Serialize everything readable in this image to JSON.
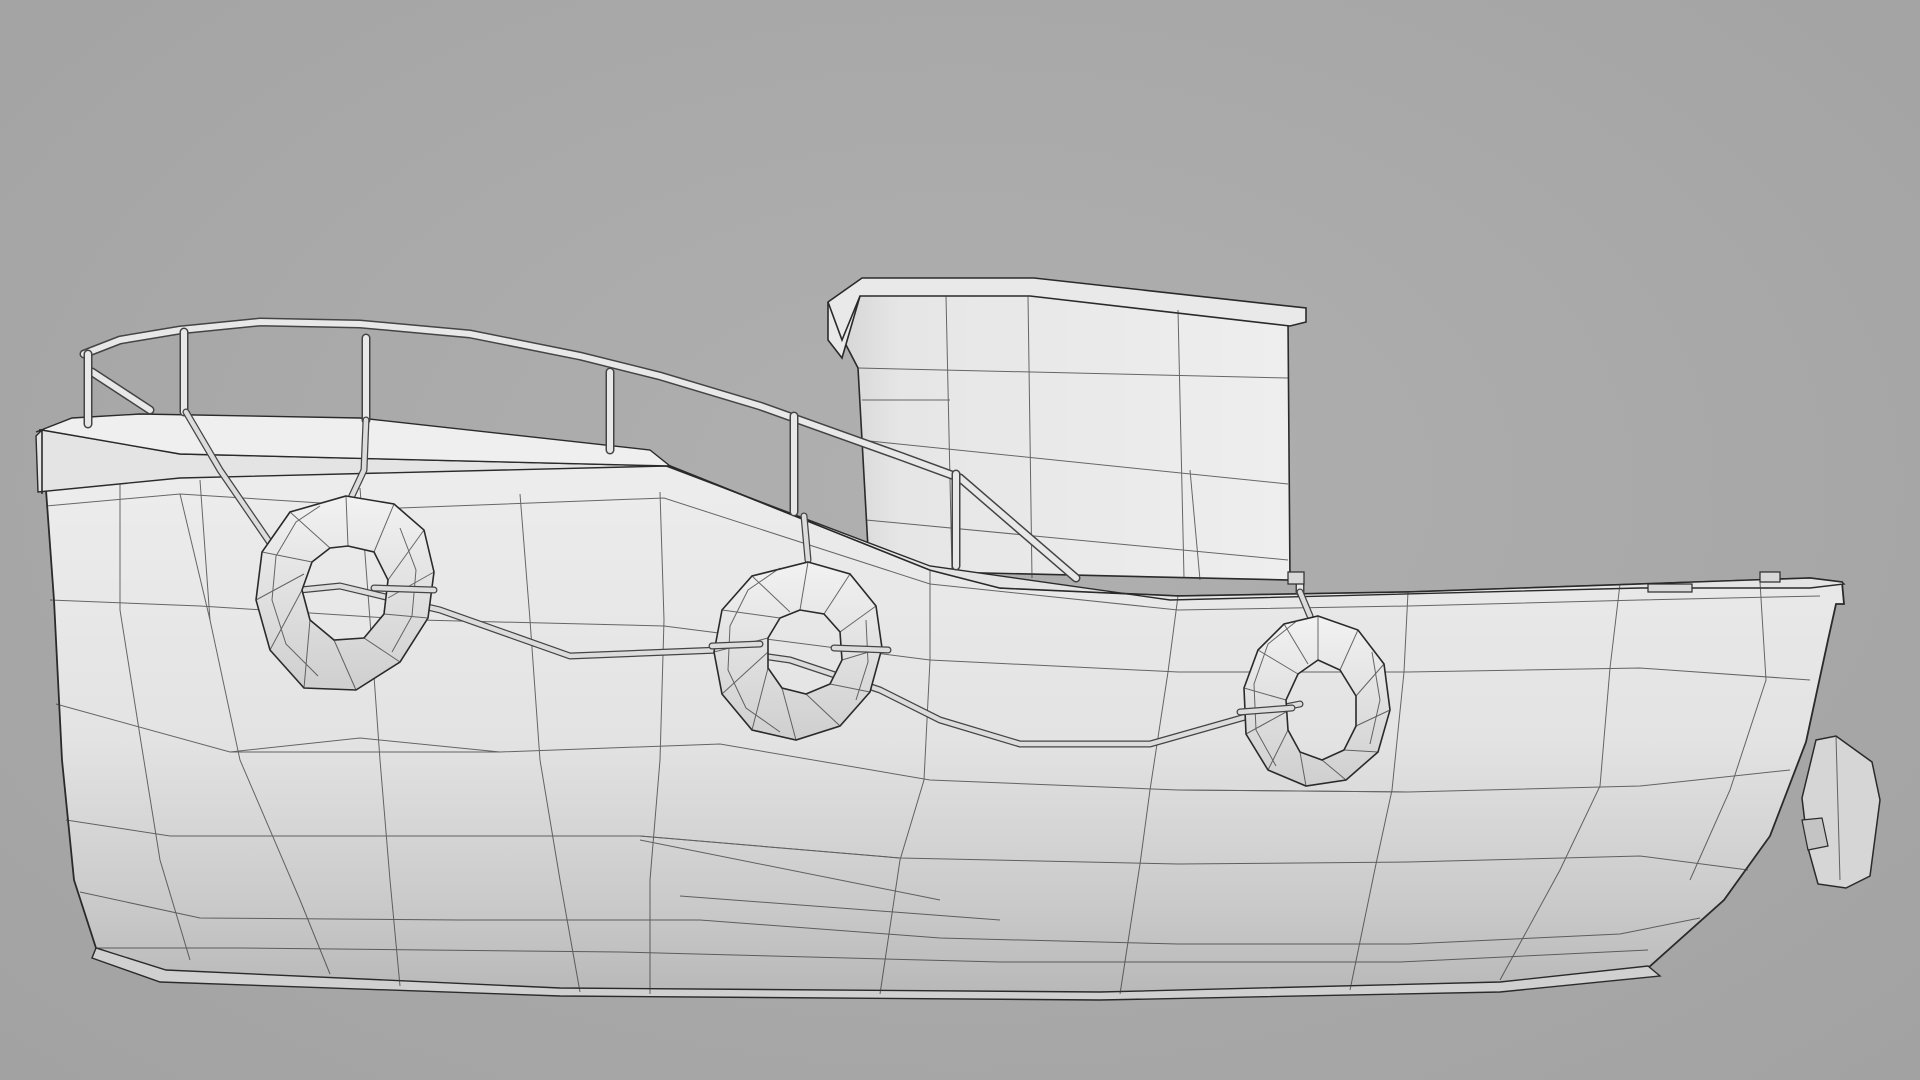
{
  "scene": {
    "subject": "boat",
    "colors": {
      "background": "#a9a9a9",
      "hull_light": "#ededed",
      "hull_mid": "#d9d9d9",
      "hull_shadow": "#bdbdbd",
      "wire": "#3a3a3a"
    },
    "life_rings": 3,
    "railing_posts": 7
  }
}
